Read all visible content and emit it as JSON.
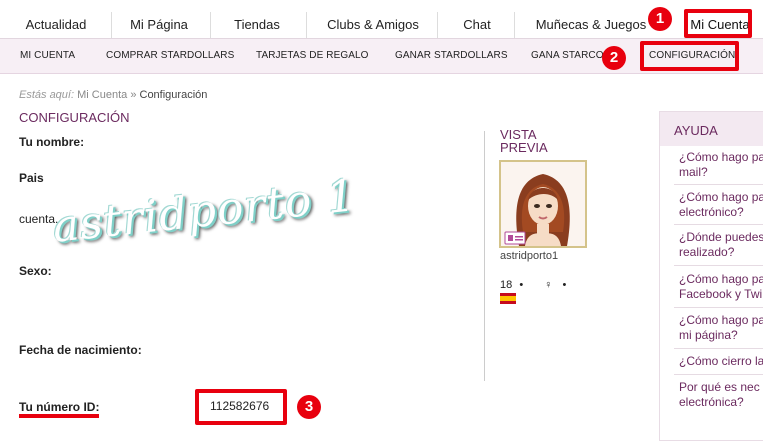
{
  "topnav": {
    "items": [
      "Actualidad",
      "Mi Página",
      "Tiendas",
      "Clubs & Amigos",
      "Chat",
      "Muñecas & Juegos",
      "Mi Cuenta"
    ]
  },
  "subnav": {
    "items": [
      "MI CUENTA",
      "COMPRAR STARDOLLARS",
      "TARJETAS DE REGALO",
      "GANAR STARDOLLARS",
      "GANA STARCOI",
      "CONFIGURACIÓN"
    ]
  },
  "breadcrumb": {
    "lead": "Estás aquí:",
    "link": "Mi Cuenta",
    "sep": "»",
    "current": "Configuración"
  },
  "main": {
    "title": "CONFIGURACIÓN",
    "name_label": "Tu nombre:",
    "country_label": "Pais",
    "account_text": "cuenta.",
    "sex_label": "Sexo:",
    "birth_label": "Fecha de nacimiento:",
    "id_label": "Tu número ID:",
    "id_value": "112582676"
  },
  "preview": {
    "title": "VISTA PREVIA",
    "username": "astridporto1",
    "age": "18",
    "gender_symbol": "♀",
    "bullet": "•"
  },
  "help": {
    "title": "AYUDA",
    "questions": [
      "¿Cómo hago pa mail?",
      "¿Cómo hago pa electrónico?",
      "¿Dónde puedes realizado?",
      "¿Cómo hago pa Facebook y Twi",
      "¿Cómo hago pa mi página?",
      "¿Cómo cierro la",
      "Por qué es nec electrónica?"
    ]
  },
  "annotations": {
    "badge1": "1",
    "badge2": "2",
    "badge3": "3",
    "accent": "#e8000e"
  },
  "watermark": "astridporto 1"
}
